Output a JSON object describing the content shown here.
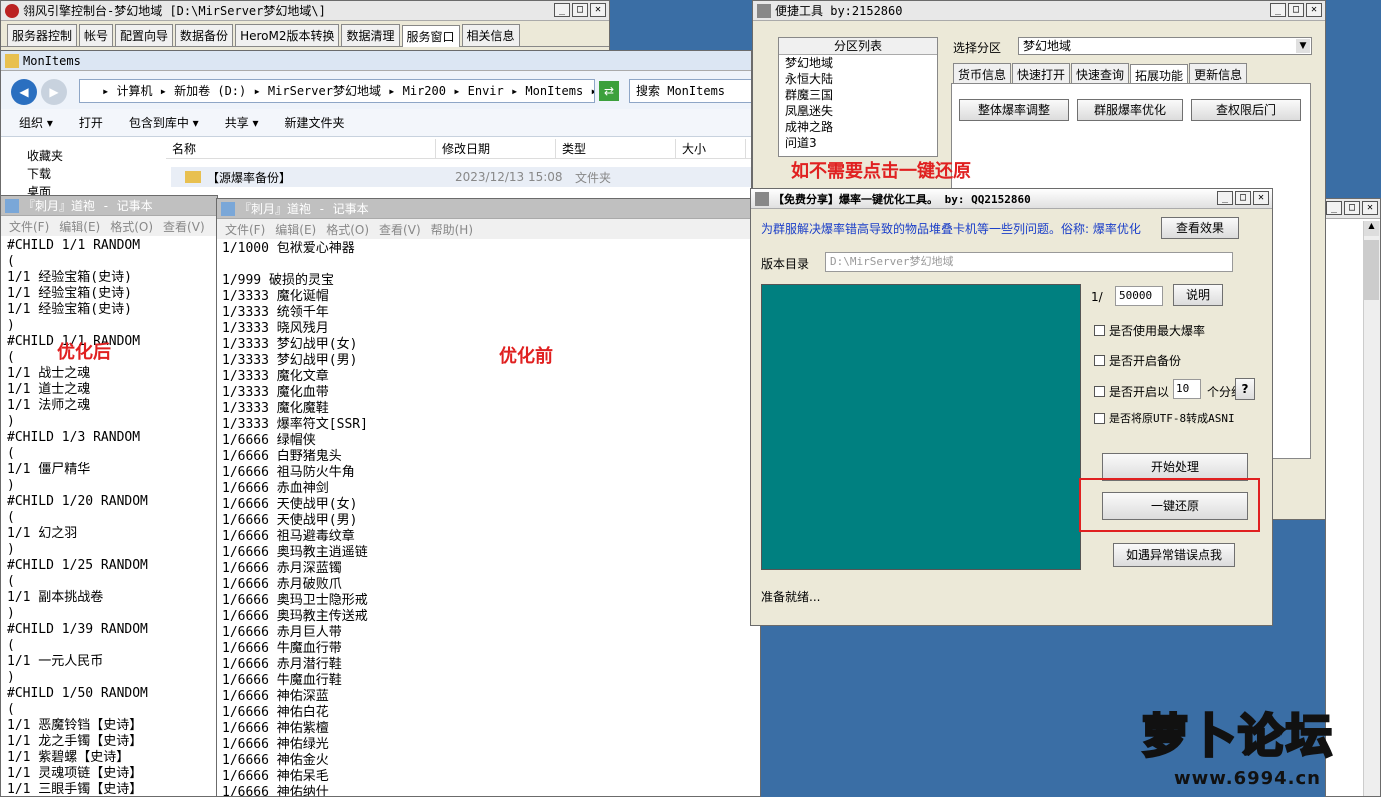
{
  "console": {
    "title": "翎风引擎控制台-梦幻地域 [D:\\MirServer梦幻地域\\]",
    "tabs": [
      "服务器控制",
      "帐号",
      "配置向导",
      "数据备份",
      "HeroM2版本转换",
      "数据清理",
      "服务窗口",
      "相关信息"
    ]
  },
  "explorer": {
    "title": "MonItems",
    "breadcrumb": "▸ 计算机 ▸ 新加卷 (D:) ▸ MirServer梦幻地域 ▸ Mir200 ▸ Envir ▸ MonItems ▸",
    "search_placeholder": "搜索 MonItems",
    "toolbar": [
      "组织 ▾",
      "打开",
      "包含到库中 ▾",
      "共享 ▾",
      "新建文件夹"
    ],
    "nav": [
      "收藏夹",
      "下载",
      "桌面"
    ],
    "columns": [
      "名称",
      "修改日期",
      "类型",
      "大小"
    ],
    "row": {
      "name": "【源爆率备份】",
      "date": "2023/12/13 15:08",
      "type": "文件夹"
    }
  },
  "notepad_left": {
    "title": "『刺月』道袍 - 记事本",
    "menu": [
      "文件(F)",
      "编辑(E)",
      "格式(O)",
      "查看(V)"
    ],
    "lines": [
      "#CHILD 1/1 RANDOM",
      "(",
      "1/1 经验宝箱(史诗)",
      "1/1 经验宝箱(史诗)",
      "1/1 经验宝箱(史诗)",
      ")",
      "#CHILD 1/1 RANDOM",
      "(",
      "1/1 战士之魂",
      "1/1 道士之魂",
      "1/1 法师之魂",
      ")",
      "#CHILD 1/3 RANDOM",
      "(",
      "1/1 僵尸精华",
      ")",
      "#CHILD 1/20 RANDOM",
      "(",
      "1/1 幻之羽",
      ")",
      "#CHILD 1/25 RANDOM",
      "(",
      "1/1 副本挑战卷",
      ")",
      "#CHILD 1/39 RANDOM",
      "(",
      "1/1 一元人民币",
      ")",
      "#CHILD 1/50 RANDOM",
      "(",
      "1/1 恶魔铃铛【史诗】",
      "1/1 龙之手镯【史诗】",
      "1/1 紫碧螺【史诗】",
      "1/1 灵魂项链【史诗】",
      "1/1 三眼手镯【史诗】"
    ]
  },
  "notepad_mid": {
    "title": "『刺月』道袍 - 记事本",
    "menu": [
      "文件(F)",
      "编辑(E)",
      "格式(O)",
      "查看(V)",
      "帮助(H)"
    ],
    "lines": [
      "1/1000 包袱爱心神器",
      "",
      "1/999 破损的灵宝",
      "1/3333 魔化诞帽",
      "1/3333 统领千年",
      "1/3333 晓风残月",
      "1/3333 梦幻战甲(女)",
      "1/3333 梦幻战甲(男)",
      "1/3333 魔化文章",
      "1/3333 魔化血带",
      "1/3333 魔化魔鞋",
      "1/3333 爆率符文[SSR]",
      "1/6666 绿帽侠",
      "1/6666 白野猪鬼头",
      "1/6666 祖马防火牛角",
      "1/6666 赤血神剑",
      "1/6666 天使战甲(女)",
      "1/6666 天使战甲(男)",
      "1/6666 祖马避毒纹章",
      "1/6666 奥玛教主逍遥链",
      "1/6666 赤月深蓝镯",
      "1/6666 赤月破败爪",
      "1/6666 奥玛卫士隐形戒",
      "1/6666 奥玛教主传送戒",
      "1/6666 赤月巨人带",
      "1/6666 牛魔血行带",
      "1/6666 赤月潜行鞋",
      "1/6666 牛魔血行鞋",
      "1/6666 神佑深蓝",
      "1/6666 神佑白花",
      "1/6666 神佑紫檀",
      "1/6666 神佑绿光",
      "1/6666 神佑金火",
      "1/6666 神佑呆毛",
      "1/6666 神佑纳什"
    ]
  },
  "annotations": {
    "after": "优化后",
    "before": "优化前",
    "restore_hint": "如不需要点击一键还原"
  },
  "quick": {
    "title": "便捷工具  by:2152860",
    "list_header": "分区列表",
    "partitions": [
      "梦幻地域",
      "永恒大陆",
      "群魔三国",
      "凤凰迷失",
      "成神之路",
      "问道3"
    ],
    "select_label": "选择分区",
    "select_value": "梦幻地域",
    "tabs": [
      "货币信息",
      "快速打开",
      "快速查询",
      "拓展功能",
      "更新信息"
    ],
    "buttons": [
      "整体爆率调整",
      "群服爆率优化",
      "查权限后门"
    ]
  },
  "tool": {
    "title": "【免费分享】爆率一键优化工具。    by: QQ2152860",
    "desc": "为群服解决爆率错高导致的物品堆叠卡机等一些列问题。俗称: 爆率优化",
    "view_effect": "查看效果",
    "version_label": "版本目录",
    "version_path": "D:\\MirServer梦幻地域",
    "ratio_prefix": "1/",
    "ratio_value": "50000",
    "explain": "说明",
    "opts": [
      "是否使用最大爆率",
      "是否开启备份",
      "是否开启以",
      "是否将原UTF-8转成ASNI"
    ],
    "group_value": "10",
    "group_suffix": "个分组",
    "qmark": "?",
    "start": "开始处理",
    "restore": "一键还原",
    "error": "如遇异常错误点我",
    "status": "准备就绪..."
  },
  "logo": {
    "brand": "萝卜论坛",
    "url": "www.6994.cn"
  }
}
